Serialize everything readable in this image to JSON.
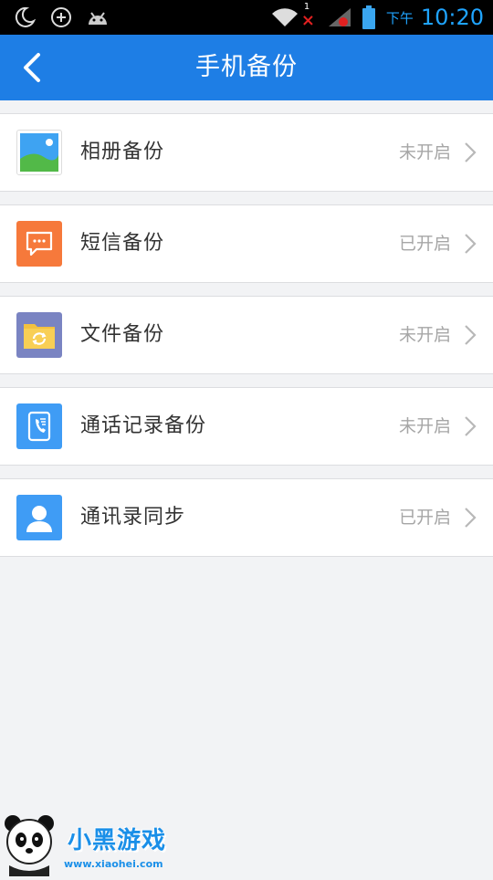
{
  "status_bar": {
    "ampm": "下午",
    "time": "10:20",
    "notification": "1",
    "icons": [
      "moon-icon",
      "add-circle-icon",
      "android-icon",
      "wifi-icon",
      "signal-icon",
      "battery-icon"
    ]
  },
  "header": {
    "title": "手机备份",
    "back_icon": "back-arrow-icon"
  },
  "items": [
    {
      "label": "相册备份",
      "status": "未开启",
      "icon": "photo-icon",
      "color": "#ffffff"
    },
    {
      "label": "短信备份",
      "status": "已开启",
      "icon": "sms-icon",
      "color": "#f6793b"
    },
    {
      "label": "文件备份",
      "status": "未开启",
      "icon": "folder-sync-icon",
      "color": "#7a84c2"
    },
    {
      "label": "通话记录备份",
      "status": "未开启",
      "icon": "call-log-icon",
      "color": "#3f9cf5"
    },
    {
      "label": "通讯录同步",
      "status": "已开启",
      "icon": "contact-icon",
      "color": "#3f9cf5"
    }
  ],
  "watermark": {
    "brand": "小黑游戏",
    "url": "www.xiaohei.com"
  },
  "colors": {
    "header_bg": "#1e7ee5",
    "page_bg": "#f2f3f5",
    "time_text": "#1fa4ff"
  }
}
